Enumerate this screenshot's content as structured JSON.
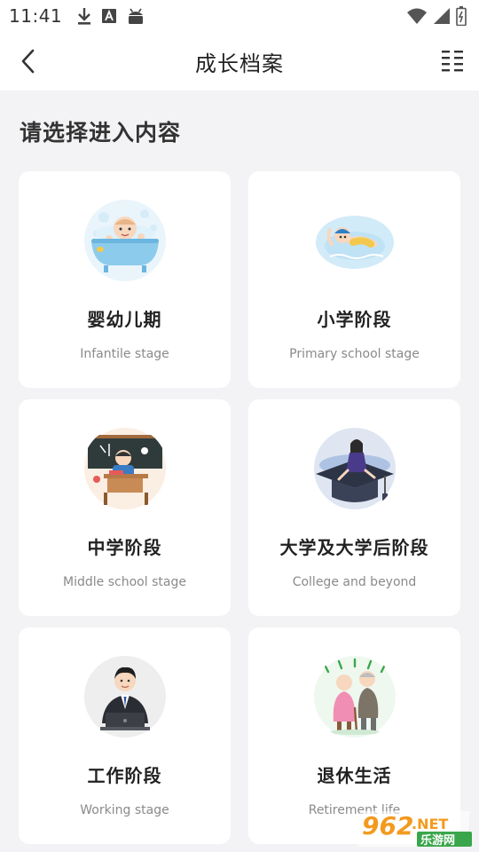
{
  "status_bar": {
    "time": "11:41",
    "left_icons": [
      "download-icon",
      "text-a-icon",
      "android-icon"
    ],
    "right_icons": [
      "wifi-icon",
      "signal-icon",
      "battery-icon"
    ]
  },
  "app_bar": {
    "title": "成长档案",
    "back_icon": "chevron-left-icon",
    "menu_icon": "grid-menu-icon"
  },
  "section_title": "请选择进入内容",
  "cards": [
    {
      "title": "婴幼儿期",
      "subtitle": "Infantile stage",
      "icon": "baby-bath-illustration"
    },
    {
      "title": "小学阶段",
      "subtitle": "Primary school stage",
      "icon": "child-swimming-illustration"
    },
    {
      "title": "中学阶段",
      "subtitle": "Middle school stage",
      "icon": "student-desk-illustration"
    },
    {
      "title": "大学及大学后阶段",
      "subtitle": "College and beyond",
      "icon": "graduate-cap-illustration"
    },
    {
      "title": "工作阶段",
      "subtitle": "Working stage",
      "icon": "office-worker-illustration"
    },
    {
      "title": "退休生活",
      "subtitle": "Retirement life",
      "icon": "elderly-couple-illustration"
    }
  ],
  "watermark": {
    "number": "962",
    "suffix": ".NET",
    "cn": "乐游网"
  },
  "colors": {
    "background": "#f3f3f5",
    "card": "#ffffff",
    "watermark_orange": "#f39a1e",
    "watermark_green": "#3aa64b"
  }
}
